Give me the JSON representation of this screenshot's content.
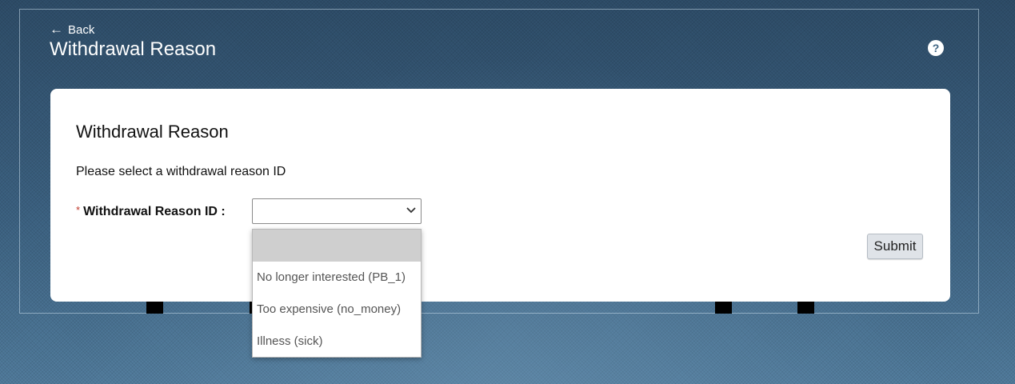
{
  "header": {
    "back_arrow": "←",
    "back_label": "Back",
    "title": "Withdrawal Reason",
    "help_icon": "?"
  },
  "form": {
    "title": "Withdrawal Reason",
    "instruction": "Please select a withdrawal reason ID",
    "required_marker": "*",
    "field_label": "Withdrawal Reason ID :",
    "selected_value": "",
    "options": [
      "",
      "No longer interested (PB_1)",
      "Too expensive (no_money)",
      "Illness (sick)"
    ],
    "submit_label": "Submit"
  },
  "colors": {
    "background": "#3e6482",
    "card": "#ffffff",
    "required": "#c0392b",
    "highlighted_option": "#cfcfcf",
    "submit_button": "#dfe3e8"
  },
  "icons": {
    "back": "left-arrow-icon",
    "help": "question-circle-icon",
    "select": "chevron-down-icon"
  }
}
